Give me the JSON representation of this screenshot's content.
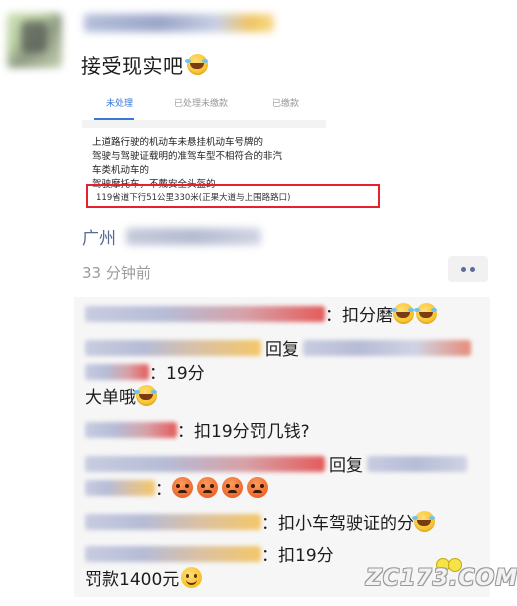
{
  "post": {
    "text": "接受现实吧",
    "card": {
      "tabs": [
        "未处理",
        "已处理未缴款",
        "已缴款"
      ],
      "violations": [
        "上道路行驶的机动车未悬挂机动车号牌的",
        "驾驶与驾驶证载明的准驾车型不相符合的非汽",
        "车类机动车的",
        "驾驶摩托车，不戴安全头盔的"
      ],
      "location": "119省道下行51公里330米(正果大道与上围路路口)"
    },
    "location_label": "广州",
    "time": "33 分钟前"
  },
  "comments": {
    "c1_text": "：扣分磨",
    "c2_reply": "回复",
    "c2_text": "：19分",
    "c3_text": "大单哦",
    "c4_text": "：扣19分罚几钱?",
    "c5_reply": "回复",
    "c6_text": "：",
    "c7_text": "：扣小车驾驶证的分",
    "c8_text": "：扣19分",
    "c9_text": "罚款1400元"
  },
  "watermark": "ZC173.COM",
  "colors": {
    "accent_blue": "#3a78d8",
    "highlight_red": "#e6212e",
    "link": "#5a6b92"
  }
}
